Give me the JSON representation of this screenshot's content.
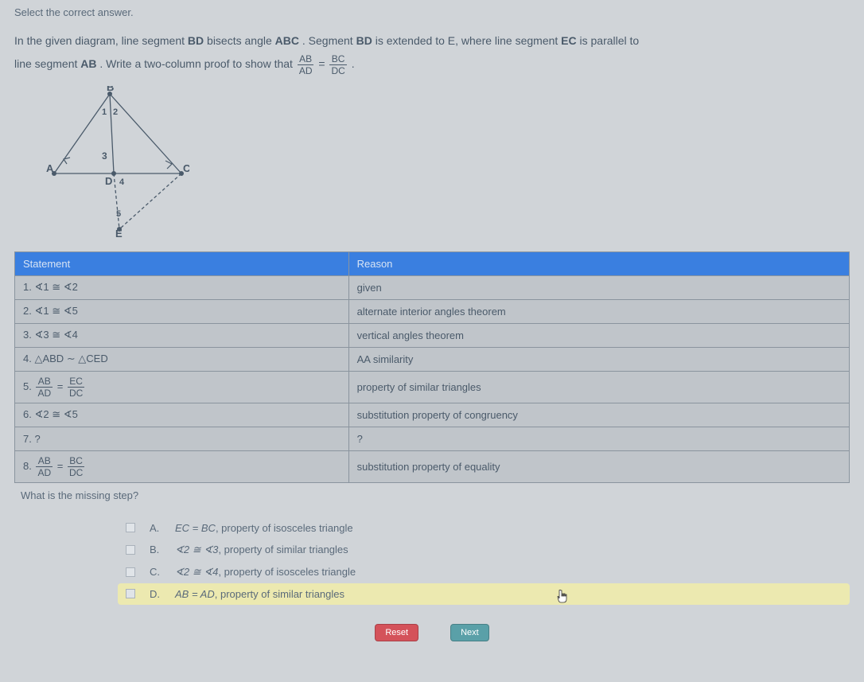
{
  "header": {
    "instruction": "Select the correct answer."
  },
  "problem": {
    "line1_a": "In the given diagram, line segment ",
    "bd": "BD",
    "line1_b": " bisects angle ",
    "abc": "ABC",
    "line1_c": ". Segment ",
    "line1_d": " is extended to E, where line segment ",
    "ec": "EC",
    "line1_e": " is parallel to",
    "line2_a": "line segment ",
    "ab": "AB",
    "line2_b": ". Write a two-column proof to show that ",
    "frac1_num": "AB",
    "frac1_den": "AD",
    "eq": " = ",
    "frac2_num": "BC",
    "frac2_den": "DC",
    "period": "."
  },
  "diagram": {
    "labels": {
      "A": "A",
      "B": "B",
      "C": "C",
      "D": "D",
      "E": "E",
      "a1": "1",
      "a2": "2",
      "a3": "3",
      "a4": "4",
      "a5": "5"
    }
  },
  "table": {
    "headers": {
      "statement": "Statement",
      "reason": "Reason"
    },
    "rows": [
      {
        "s": "1. ∢1 ≅ ∢2",
        "r": "given"
      },
      {
        "s": "2. ∢1 ≅ ∢5",
        "r": "alternate interior angles theorem"
      },
      {
        "s": "3. ∢3 ≅ ∢4",
        "r": "vertical angles theorem"
      },
      {
        "s": "4. △ABD ∼ △CED",
        "r": "AA similarity"
      },
      {
        "s": "5. AB⁄AD = EC⁄DC",
        "r": "property of similar triangles",
        "isfrac": true,
        "f1n": "AB",
        "f1d": "AD",
        "f2n": "EC",
        "f2d": "DC",
        "pre": "5. "
      },
      {
        "s": "6. ∢2 ≅ ∢5",
        "r": "substitution property of congruency"
      },
      {
        "s": "7. ?",
        "r": "?"
      },
      {
        "s": "8. AB⁄AD = BC⁄DC",
        "r": "substitution property of equality",
        "isfrac": true,
        "f1n": "AB",
        "f1d": "AD",
        "f2n": "BC",
        "f2d": "DC",
        "pre": "8. "
      }
    ]
  },
  "below": "What is the missing step?",
  "options": [
    {
      "letter": "A.",
      "math": "EC = BC",
      "rest": ", property of isosceles triangle",
      "hl": false
    },
    {
      "letter": "B.",
      "math": "∢2 ≅ ∢3",
      "rest": ", property of similar triangles",
      "hl": false
    },
    {
      "letter": "C.",
      "math": "∢2 ≅ ∢4",
      "rest": ", property of isosceles triangle",
      "hl": false
    },
    {
      "letter": "D.",
      "math": "AB = AD",
      "rest": ", property of similar triangles",
      "hl": true
    }
  ],
  "buttons": {
    "reset": "Reset",
    "next": "Next"
  },
  "icons": {
    "cursor": "hand-cursor-icon"
  }
}
